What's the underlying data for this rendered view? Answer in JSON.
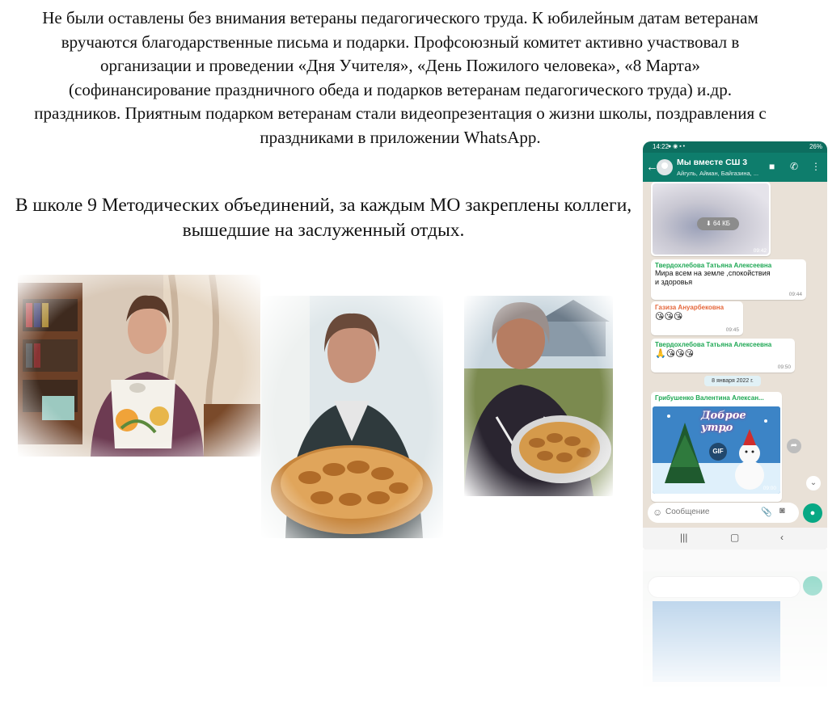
{
  "paragraph1": "Не были оставлены без внимания ветераны педагогического труда. К юбилейным датам ветеранам вручаются благодарственные письма и подарки. Профсоюзный комитет активно участвовал в организации и проведении «Дня Учителя», «День Пожилого человека», «8 Марта» (софинансирование праздничного обеда и подарков ветеранам педагогического труда)  и.др. праздников. Приятным подарком ветеранам стали видеопрезентация о жизни школы, поздравления с праздниками в приложении WhatsApp.",
  "paragraph2": "В школе 9 Методических объединений, за каждым МО закреплены коллеги, вышедшие на заслуженный отдых.",
  "phone": {
    "status_time": "14:22",
    "status_right": "26%",
    "group_name": "Мы вместе СШ 3",
    "group_members": "Айгуль, Айман, Байгазина, ...",
    "media_size": "64 КБ",
    "messages": [
      {
        "time": "09:42"
      },
      {
        "sender": "Твердохлебова Татьяна Алексеевна",
        "text": "Мира всем на земле ,спокойствия и здоровья",
        "time": "09:44"
      },
      {
        "sender": "Газиза Ануарбековна",
        "text": "😘😘😘",
        "time": "09:45"
      },
      {
        "sender": "Твердохлебова Татьяна Алексеевна",
        "text": "🙏😘😘😘",
        "time": "09:50"
      },
      {
        "sender": "Грибушенко Валентина Алексан...",
        "time": "09:00"
      }
    ],
    "date_separator": "8 января 2022 г.",
    "gif_label": "GIF",
    "gif_caption": "Доброе утро",
    "input_placeholder": "Сообщение",
    "colors": {
      "header": "#0e7d6c",
      "chat_bg": "#e9e1d7",
      "mic": "#07a884",
      "sender_green": "#1fa855",
      "sender_orange": "#e5673b"
    }
  }
}
